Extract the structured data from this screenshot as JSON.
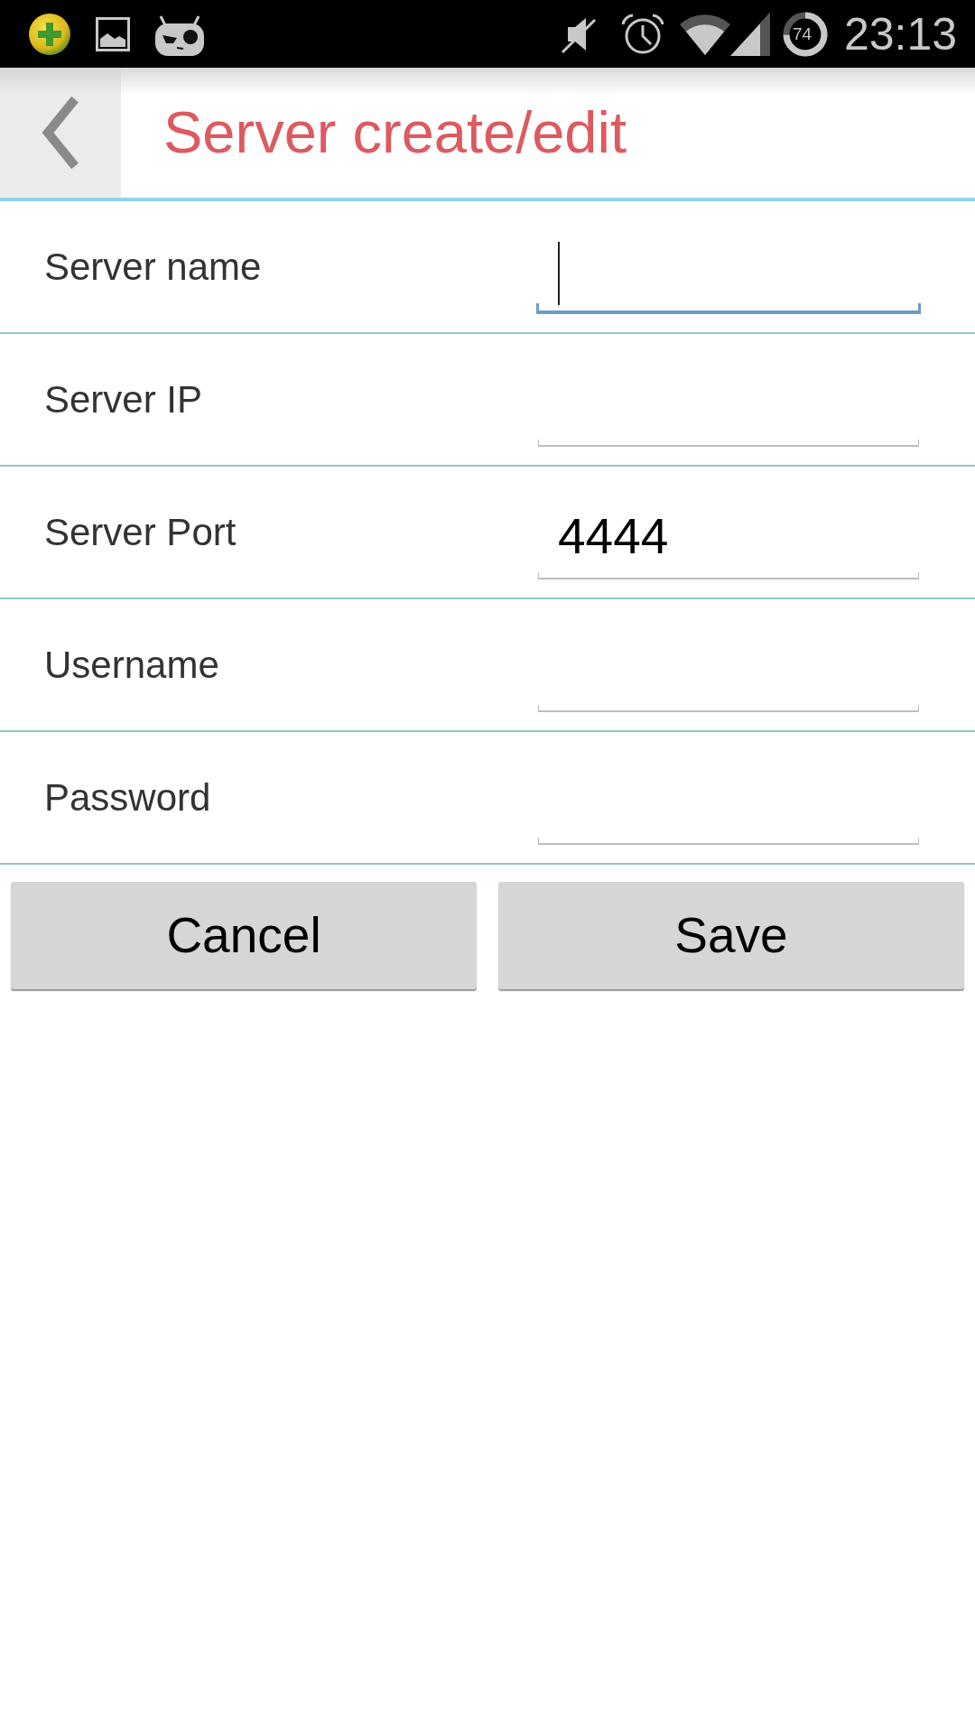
{
  "status_bar": {
    "battery_percent": "74",
    "time": "23:13"
  },
  "header": {
    "title": "Server create/edit"
  },
  "fields": [
    {
      "label": "Server name",
      "focused": true
    },
    {
      "label": "Server IP",
      "focused": false
    },
    {
      "label": "Server Port",
      "value": "4444",
      "focused": false
    },
    {
      "label": "Username",
      "focused": false
    },
    {
      "label": "Password",
      "focused": false
    }
  ],
  "buttons": [
    {
      "label": "Cancel"
    },
    {
      "label": "Save"
    }
  ]
}
